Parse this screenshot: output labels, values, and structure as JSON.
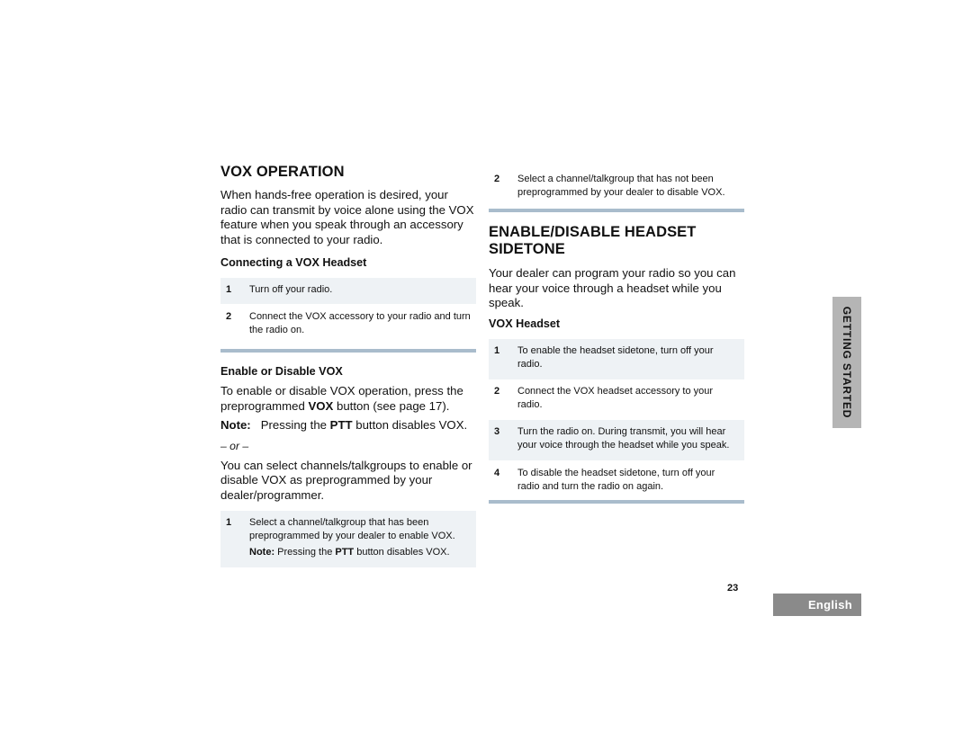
{
  "left": {
    "title": "VOX OPERATION",
    "intro": "When hands-free operation is desired, your radio can transmit by voice alone using the VOX feature when you speak through an accessory that is connected to your radio.",
    "connecting": {
      "heading": "Connecting a VOX Headset",
      "steps": [
        {
          "num": "1",
          "text": "Turn off your radio."
        },
        {
          "num": "2",
          "text": "Connect the VOX accessory to your radio and turn the radio on."
        }
      ]
    },
    "enable": {
      "heading": "Enable or Disable VOX",
      "para1_pre": "To enable or disable VOX operation, press the preprogrammed ",
      "para1_bold": "VOX",
      "para1_post": " button (see page 17).",
      "note_label": "Note:",
      "note_pre": "Pressing the ",
      "note_bold": "PTT",
      "note_post": " button disables VOX.",
      "or": "– or –",
      "para2": "You can select channels/talkgroups to enable or disable VOX as preprogrammed by your dealer/programmer.",
      "steps": [
        {
          "num": "1",
          "text": "Select a channel/talkgroup that has been preprogrammed by your dealer to enable VOX.",
          "note_label": "Note:",
          "note_pre": " Pressing the ",
          "note_bold": "PTT",
          "note_post": " button disables VOX."
        }
      ]
    }
  },
  "right": {
    "cont_steps": [
      {
        "num": "2",
        "text": "Select a channel/talkgroup that has not been preprogrammed by your dealer to disable VOX."
      }
    ],
    "title_line1": "ENABLE/DISABLE HEADSET",
    "title_line2": "SIDETONE",
    "intro": "Your dealer can program your radio so you can hear your voice through a headset while you speak.",
    "vox_headset": {
      "heading": "VOX Headset",
      "steps": [
        {
          "num": "1",
          "text": "To enable the headset sidetone, turn off your radio."
        },
        {
          "num": "2",
          "text": "Connect the VOX headset accessory to your radio."
        },
        {
          "num": "3",
          "text": "Turn the radio on. During transmit,  you will hear your voice through the headset while you speak."
        },
        {
          "num": "4",
          "text": "To disable the headset sidetone, turn off your radio and turn the radio on again."
        }
      ]
    }
  },
  "side_tab": "GETTING STARTED",
  "page_number": "23",
  "language_tab": "English"
}
